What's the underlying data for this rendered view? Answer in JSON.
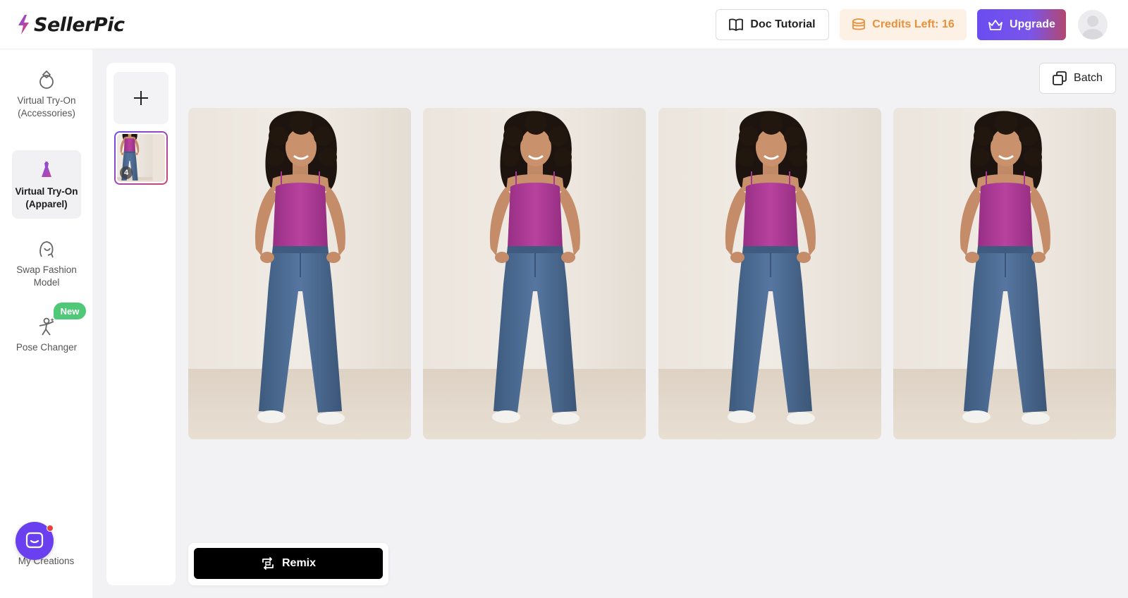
{
  "app": {
    "brand": "SellerPic"
  },
  "header": {
    "doc_tutorial_label": "Doc Tutorial",
    "credits_label": "Credits Left: 16",
    "upgrade_label": "Upgrade"
  },
  "sidebar": {
    "items": [
      {
        "label": "Virtual Try-On (Accessories)",
        "icon": "ring-icon",
        "active": false
      },
      {
        "label": "Virtual Try-On (Apparel)",
        "icon": "dress-icon",
        "active": true
      },
      {
        "label": "Swap Fashion Model",
        "icon": "face-swap-icon",
        "active": false
      },
      {
        "label": "Pose Changer",
        "icon": "pose-icon",
        "active": false,
        "badge": "New"
      }
    ],
    "my_creations_label": "My Creations"
  },
  "thumbnails": {
    "count_badge": "4"
  },
  "toolbar": {
    "batch_label": "Batch"
  },
  "gallery": {
    "images": [
      {
        "subject": "woman in magenta tank top and blue flared jeans"
      },
      {
        "subject": "woman in magenta tank top and blue flared jeans"
      },
      {
        "subject": "woman in magenta tank top and blue flared jeans"
      },
      {
        "subject": "woman in magenta tank top and blue flared jeans"
      }
    ]
  },
  "actions": {
    "remix_label": "Remix"
  },
  "colors": {
    "accent_purple": "#6a4cf0",
    "upgrade_gradient_end": "#b2476f",
    "credits_text": "#e8903a",
    "credits_bg": "#fdf1e6",
    "new_badge": "#4fc878",
    "top_color": "#a83a93",
    "jeans_color": "#47678c"
  }
}
